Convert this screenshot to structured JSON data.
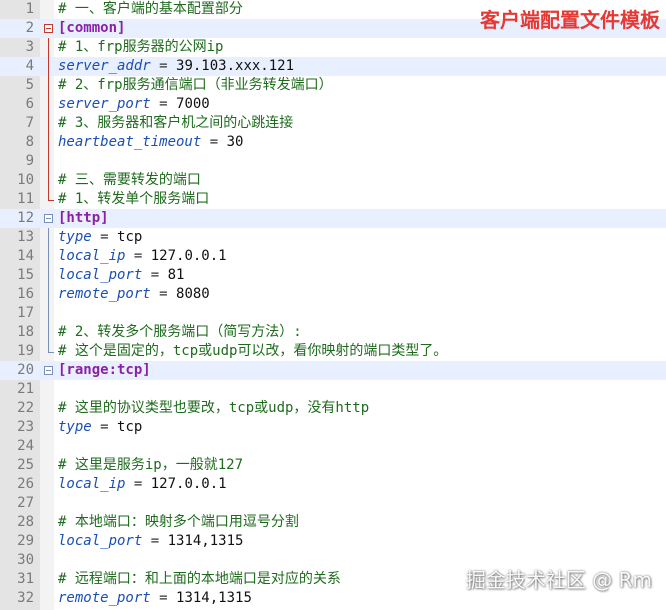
{
  "title_badge": "客户端配置文件模板",
  "watermark": "掘金技术社区 @ Rm",
  "lines": [
    {
      "num": "1",
      "kind": "comment",
      "text": "# 一、客户端的基本配置部分"
    },
    {
      "num": "2",
      "kind": "section",
      "text": "[common]"
    },
    {
      "num": "3",
      "kind": "comment",
      "text": "# 1、frp服务器的公网ip"
    },
    {
      "num": "4",
      "kind": "kv",
      "key": "server_addr",
      "eq": " = ",
      "value": "39.103.xxx.121"
    },
    {
      "num": "5",
      "kind": "comment",
      "text": "# 2、frp服务通信端口（非业务转发端口）"
    },
    {
      "num": "6",
      "kind": "kv",
      "key": "server_port",
      "eq": " = ",
      "value": "7000"
    },
    {
      "num": "7",
      "kind": "comment",
      "text": "# 3、服务器和客户机之间的心跳连接"
    },
    {
      "num": "8",
      "kind": "kv",
      "key": "heartbeat_timeout",
      "eq": " = ",
      "value": "30"
    },
    {
      "num": "9",
      "kind": "blank",
      "text": ""
    },
    {
      "num": "10",
      "kind": "comment",
      "text": "# 三、需要转发的端口"
    },
    {
      "num": "11",
      "kind": "comment",
      "text": "# 1、转发单个服务端口"
    },
    {
      "num": "12",
      "kind": "section",
      "text": "[http]"
    },
    {
      "num": "13",
      "kind": "kv",
      "key": "type",
      "eq": " = ",
      "value": "tcp"
    },
    {
      "num": "14",
      "kind": "kv",
      "key": "local_ip",
      "eq": " = ",
      "value": "127.0.0.1"
    },
    {
      "num": "15",
      "kind": "kv",
      "key": "local_port",
      "eq": " = ",
      "value": "81"
    },
    {
      "num": "16",
      "kind": "kv",
      "key": "remote_port",
      "eq": " = ",
      "value": "8080"
    },
    {
      "num": "17",
      "kind": "blank",
      "text": ""
    },
    {
      "num": "18",
      "kind": "comment",
      "text": "# 2、转发多个服务端口（简写方法）:"
    },
    {
      "num": "19",
      "kind": "comment",
      "text": "# 这个是固定的，tcp或udp可以改，看你映射的端口类型了。"
    },
    {
      "num": "20",
      "kind": "section",
      "text": "[range:tcp]"
    },
    {
      "num": "21",
      "kind": "blank",
      "text": ""
    },
    {
      "num": "22",
      "kind": "comment",
      "text": "# 这里的协议类型也要改，tcp或udp，没有http"
    },
    {
      "num": "23",
      "kind": "kv",
      "key": "type",
      "eq": " = ",
      "value": "tcp"
    },
    {
      "num": "24",
      "kind": "blank",
      "text": ""
    },
    {
      "num": "25",
      "kind": "comment",
      "text": "# 这里是服务ip，一般就127"
    },
    {
      "num": "26",
      "kind": "kv",
      "key": "local_ip",
      "eq": " = ",
      "value": "127.0.0.1"
    },
    {
      "num": "27",
      "kind": "blank",
      "text": ""
    },
    {
      "num": "28",
      "kind": "comment",
      "text": "# 本地端口：映射多个端口用逗号分割"
    },
    {
      "num": "29",
      "kind": "kv",
      "key": "local_port",
      "eq": " = ",
      "value": "1314,1315"
    },
    {
      "num": "30",
      "kind": "blank",
      "text": ""
    },
    {
      "num": "31",
      "kind": "comment",
      "text": "# 远程端口：和上面的本地端口是对应的关系"
    },
    {
      "num": "32",
      "kind": "kv",
      "key": "remote_port",
      "eq": " = ",
      "value": "1314,1315"
    }
  ]
}
